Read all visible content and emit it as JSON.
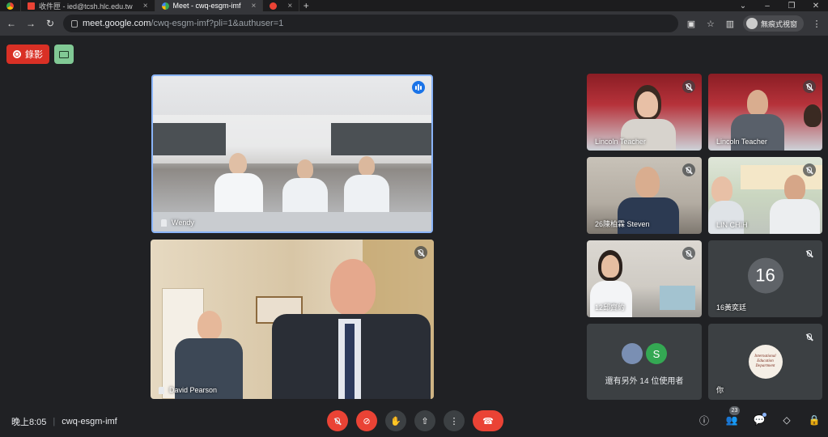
{
  "browser": {
    "tabs": [
      {
        "label": "",
        "favicon_color": "#e8eaed"
      },
      {
        "label": "收件匣 - ied@tcsh.hlc.edu.tw",
        "favicon_color": "#ea4335"
      },
      {
        "label": "Meet - cwq-esgm-imf",
        "favicon_color": "#34a853"
      },
      {
        "label": "",
        "favicon_color": "#ea4335"
      }
    ],
    "new_tab_label": "+",
    "url_host": "meet.google.com",
    "url_path": "/cwq-esgm-imf?pli=1&authuser=1",
    "profile_label": "無痕式視窗"
  },
  "meet": {
    "record_label": "錄影",
    "tiles": {
      "wendy": {
        "name": "Wendy"
      },
      "david": {
        "name": "David Pearson"
      },
      "lincoln1": {
        "name": "Lincoln Teacher"
      },
      "lincoln2": {
        "name": "Lincoln Teacher"
      },
      "steven": {
        "name": "26陳柏霖 Steven"
      },
      "linchih": {
        "name": "LIN CHIH"
      },
      "t12": {
        "name": "12邱齊約"
      },
      "t16": {
        "name": "16黃奕廷",
        "avatar_text": "16"
      },
      "others": {
        "initial": "S",
        "label": "還有另外 14 位使用者"
      },
      "you": {
        "name": "你",
        "logo_text": "International Education Department"
      }
    },
    "bottom": {
      "time": "晚上8:05",
      "meeting_code": "cwq-esgm-imf",
      "participants_count": "23"
    }
  },
  "colors": {
    "accent_blue": "#1a73e8",
    "danger_red": "#ea4335",
    "bg": "#202124"
  }
}
